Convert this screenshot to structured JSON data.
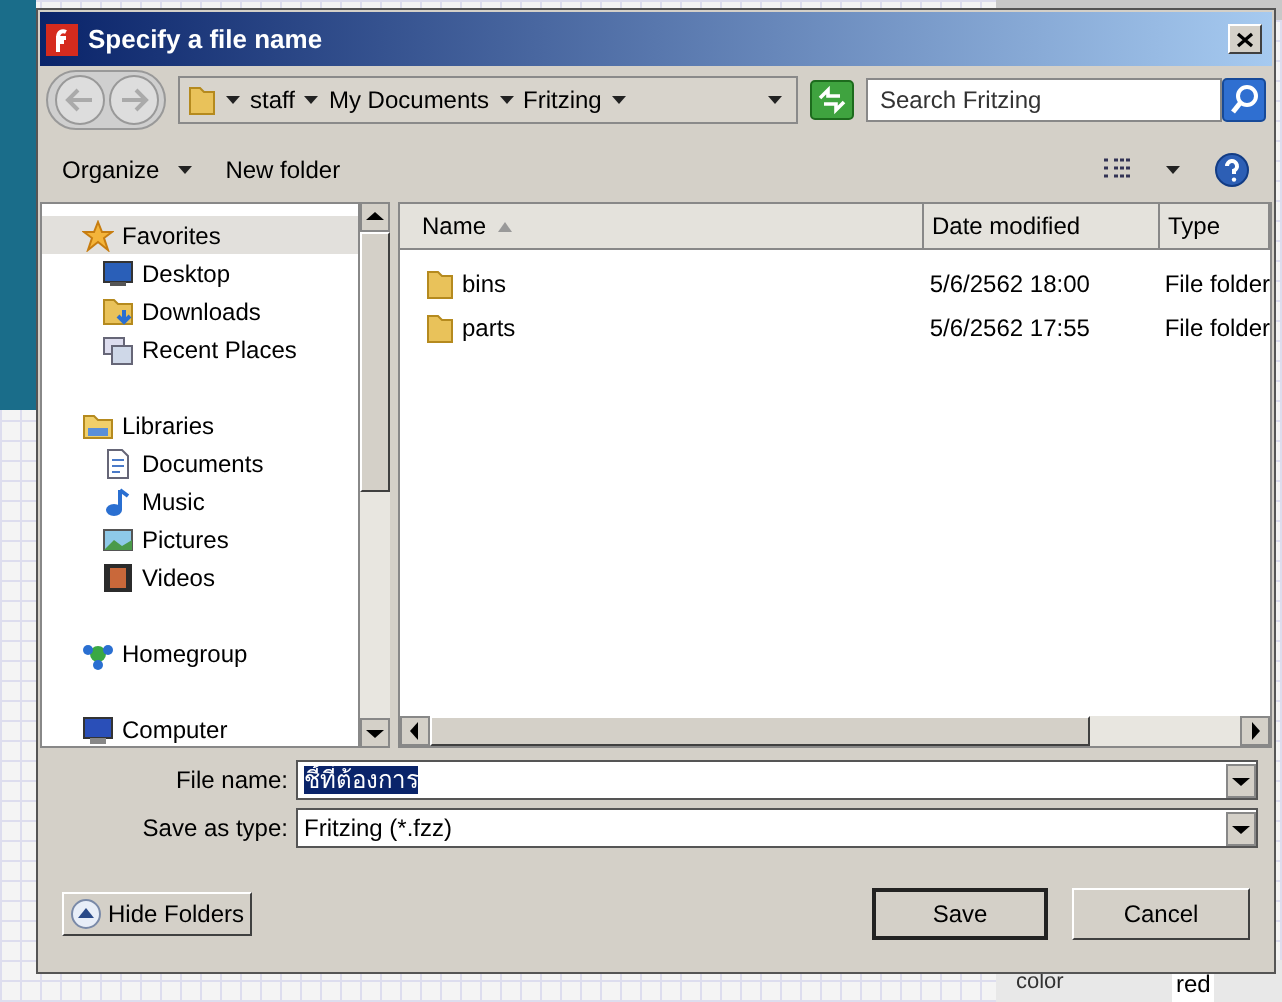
{
  "background": {
    "property": {
      "label": "color",
      "value": "red"
    }
  },
  "window": {
    "title": "Specify a file name"
  },
  "address": {
    "crumbs": [
      "staff",
      "My Documents",
      "Fritzing"
    ]
  },
  "search": {
    "placeholder": "Search Fritzing"
  },
  "toolbar": {
    "organize": "Organize",
    "new_folder": "New folder"
  },
  "nav": [
    {
      "label": "Favorites",
      "kind": "group",
      "selected": true,
      "children": [
        {
          "label": "Desktop",
          "kind": "desktop",
          "selected": false
        },
        {
          "label": "Downloads",
          "kind": "downloads",
          "selected": false
        },
        {
          "label": "Recent Places",
          "kind": "recent",
          "selected": false
        }
      ]
    },
    {
      "label": "Libraries",
      "kind": "libraries",
      "selected": false,
      "children": [
        {
          "label": "Documents",
          "kind": "documents",
          "selected": false
        },
        {
          "label": "Music",
          "kind": "music",
          "selected": false
        },
        {
          "label": "Pictures",
          "kind": "pictures",
          "selected": false
        },
        {
          "label": "Videos",
          "kind": "videos",
          "selected": false
        }
      ]
    },
    {
      "label": "Homegroup",
      "kind": "homegroup",
      "selected": false
    },
    {
      "label": "Computer",
      "kind": "computer",
      "selected": false
    }
  ],
  "columns": [
    {
      "label": "Name",
      "sorted": true
    },
    {
      "label": "Date modified",
      "sorted": false
    },
    {
      "label": "Type",
      "sorted": false
    }
  ],
  "rows": [
    {
      "name": "bins",
      "date": "5/6/2562 18:00",
      "type": "File folder"
    },
    {
      "name": "parts",
      "date": "5/6/2562 17:55",
      "type": "File folder"
    }
  ],
  "form": {
    "file_name_label": "File name:",
    "file_name": "ชี้ที่ต้องการ",
    "type_label": "Save as type:",
    "type": "Fritzing (*.fzz)"
  },
  "buttons": {
    "hide_folders": "Hide Folders",
    "save": "Save",
    "cancel": "Cancel"
  }
}
